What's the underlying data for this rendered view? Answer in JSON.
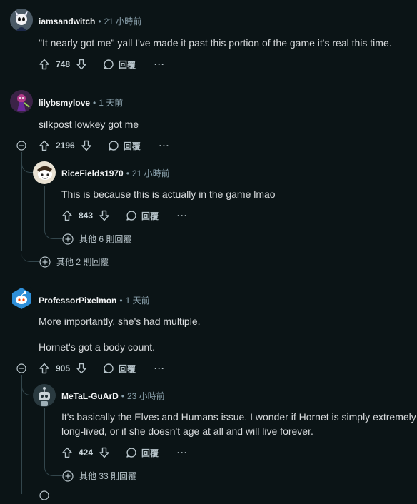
{
  "comments": [
    {
      "user": "iamsandwitch",
      "time": "21 小時前",
      "lines": [
        "\"It nearly got me\" yall I've made it past this portion of the game it's real this time."
      ],
      "votes": "748"
    },
    {
      "user": "lilybsmylove",
      "time": "1 天前",
      "lines": [
        "silkpost lowkey got me"
      ],
      "votes": "2196"
    },
    {
      "user": "RiceFields1970",
      "time": "21 小時前",
      "lines": [
        "This is because this is actually in the game lmao"
      ],
      "votes": "843"
    },
    {
      "user": "ProfessorPixelmon",
      "time": "1 天前",
      "lines": [
        "More importantly, she's had multiple.",
        "Hornet's got a body count."
      ],
      "votes": "905"
    },
    {
      "user": "MeTaL-GuArD",
      "time": "23 小時前",
      "lines": [
        "It's basically the Elves and Humans issue. I wonder if Hornet is simply extremely",
        "long-lived, or if she doesn't age at all and will live forever."
      ],
      "votes": "424"
    }
  ],
  "labels": {
    "separator": "•",
    "reply": "回覆",
    "more": "···"
  },
  "more_replies": [
    "其他 6 則回覆",
    "其他 2 則回覆",
    "其他 33 則回覆"
  ],
  "icons": {
    "upvote": "arrow-up-icon",
    "downvote": "arrow-down-icon",
    "reply": "speech-bubble-icon",
    "collapse": "minus-circle-icon",
    "expand": "plus-circle-icon"
  },
  "colors": {
    "background": "#0b1416",
    "text": "#d7dadc",
    "meta": "#8ba2ad",
    "thread_line": "#33464c"
  }
}
